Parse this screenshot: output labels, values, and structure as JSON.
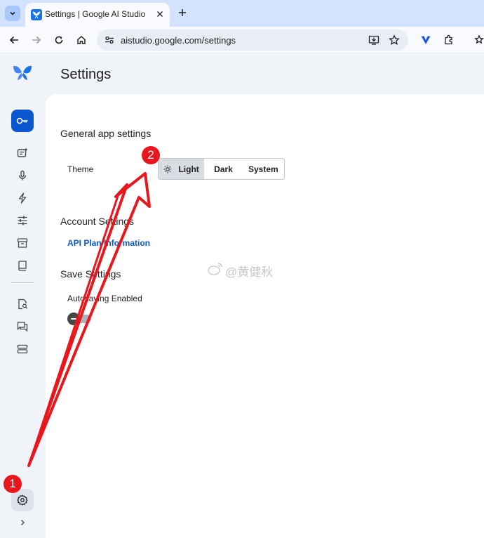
{
  "browser": {
    "tab_title": "Settings | Google AI Studio",
    "url": "aistudio.google.com/settings"
  },
  "app": {
    "page_title": "Settings",
    "sidebar": {
      "icons": [
        "key-icon",
        "new-prompt-icon",
        "microphone-icon",
        "bolt-icon",
        "tune-icon",
        "archive-icon",
        "book-icon",
        "doc-search-icon",
        "forum-icon",
        "storage-icon"
      ],
      "settings_icon": "gear-icon",
      "expand_icon": "chevron-right-icon"
    }
  },
  "settings": {
    "general_title": "General app settings",
    "theme_label": "Theme",
    "theme_options": [
      "Light",
      "Dark",
      "System"
    ],
    "theme_selected": "Light",
    "account_title": "Account Settings",
    "api_plan_link": "API Plan Information",
    "save_title": "Save Settings",
    "autosave_label": "Autosaving Enabled",
    "autosave_enabled": false
  },
  "annotations": {
    "badge_1": "1",
    "badge_2": "2",
    "watermark": "@黄健秋"
  },
  "colors": {
    "accent": "#0b57d0",
    "annotation_red": "#e8171e",
    "tab_strip": "#d3e3fd"
  }
}
